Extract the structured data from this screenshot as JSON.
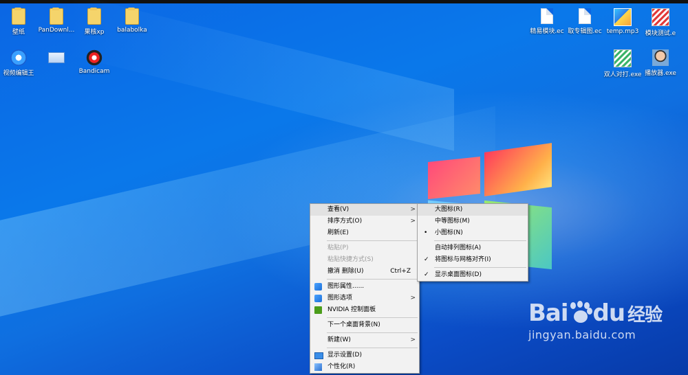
{
  "desktop": {
    "icons_left": [
      {
        "label": "壁纸",
        "icon": "folder-icon"
      },
      {
        "label": "PanDownl...",
        "icon": "folder-icon"
      },
      {
        "label": "果核xp",
        "icon": "folder-icon"
      },
      {
        "label": "balabolka",
        "icon": "folder-icon"
      },
      {
        "label": "视频编辑王",
        "icon": "video-editor-icon"
      },
      {
        "label": "",
        "icon": "computer-icon"
      },
      {
        "label": "Bandicam",
        "icon": "bandicam-icon"
      }
    ],
    "icons_right": [
      {
        "label": "精易模块.ec",
        "icon": "document-icon"
      },
      {
        "label": "取专辑图.ec",
        "icon": "document-icon"
      },
      {
        "label": "temp.mp3",
        "icon": "audio-file-icon"
      },
      {
        "label": "模块测试.e",
        "icon": "program-icon"
      },
      {
        "label": "双人对打.exe",
        "icon": "program-icon"
      },
      {
        "label": "播放器.exe",
        "icon": "program-icon"
      }
    ]
  },
  "context_menu": {
    "items": [
      {
        "label": "查看(V)",
        "has_submenu": true,
        "highlighted": true
      },
      {
        "label": "排序方式(O)",
        "has_submenu": true
      },
      {
        "label": "刷新(E)"
      },
      {
        "label": "粘贴(P)",
        "disabled": true
      },
      {
        "label": "粘贴快捷方式(S)",
        "disabled": true
      },
      {
        "label": "撤消 删除(U)",
        "shortcut": "Ctrl+Z"
      },
      {
        "label": "图形属性......",
        "icon": "graphics-icon"
      },
      {
        "label": "图形选项",
        "icon": "graphics-icon",
        "has_submenu": true
      },
      {
        "label": "NVIDIA 控制面板",
        "icon": "nvidia-icon"
      },
      {
        "label": "下一个桌面背景(N)"
      },
      {
        "label": "新建(W)",
        "has_submenu": true
      },
      {
        "label": "显示设置(D)",
        "icon": "display-icon"
      },
      {
        "label": "个性化(R)",
        "icon": "personalize-icon"
      }
    ],
    "arrow_glyph": ">"
  },
  "view_submenu": {
    "items": [
      {
        "label": "大图标(R)",
        "highlighted": true
      },
      {
        "label": "中等图标(M)"
      },
      {
        "label": "小图标(N)",
        "mark": "•"
      },
      {
        "label": "自动排列图标(A)"
      },
      {
        "label": "将图标与网格对齐(I)",
        "mark": "✓"
      },
      {
        "label": "显示桌面图标(D)",
        "mark": "✓"
      }
    ]
  },
  "watermark": {
    "brand_left": "Bai",
    "brand_right": "du",
    "suffix": "经验",
    "url": "jingyan.baidu.com"
  },
  "colors": {
    "desktop_blue": "#0b66e4",
    "menu_bg": "#f2f2f2",
    "menu_highlight": "#e2e2e2",
    "disabled_text": "#9a9a9a"
  }
}
